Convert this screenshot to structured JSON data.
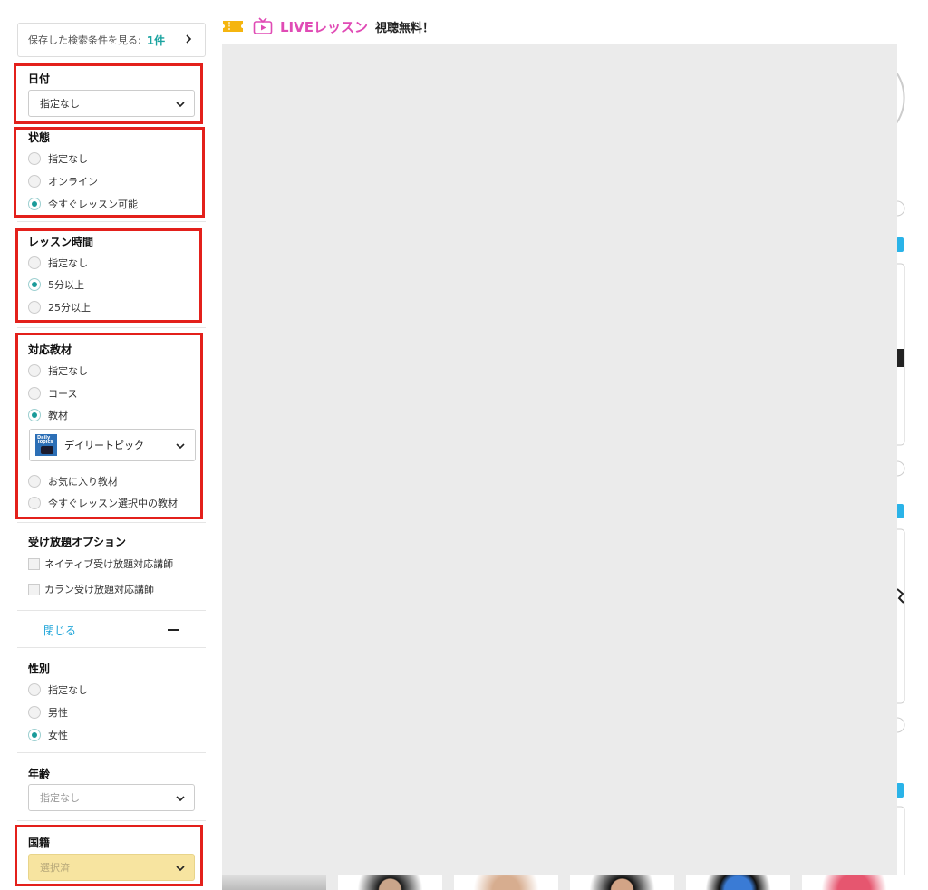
{
  "sidebar": {
    "saved_search": {
      "label": "保存した検索条件を見る:",
      "count": "1件"
    },
    "date": {
      "title": "日付",
      "value": "指定なし"
    },
    "status": {
      "title": "状態",
      "options": [
        "指定なし",
        "オンライン",
        "今すぐレッスン可能"
      ],
      "selected": "今すぐレッスン可能"
    },
    "lesson_time": {
      "title": "レッスン時間",
      "options": [
        "指定なし",
        "5分以上",
        "25分以上"
      ],
      "selected": "5分以上"
    },
    "material": {
      "title": "対応教材",
      "options": [
        "指定なし",
        "コース",
        "教材"
      ],
      "selected": "教材",
      "dropdown_value": "デイリートピック",
      "thumb_text": "Daily Topics",
      "extra_options": [
        "お気に入り教材",
        "今すぐレッスン選択中の教材"
      ]
    },
    "unlimited": {
      "title": "受け放題オプション",
      "options": [
        "ネイティブ受け放題対応講師",
        "カラン受け放題対応講師"
      ]
    },
    "close_label": "閉じる",
    "gender": {
      "title": "性別",
      "options": [
        "指定なし",
        "男性",
        "女性"
      ],
      "selected": "女性"
    },
    "age": {
      "title": "年齢",
      "value": "指定なし"
    },
    "nationality": {
      "title": "国籍",
      "value": "選択済"
    }
  },
  "main": {
    "live_title": "LIVEレッスン",
    "live_sub": "視聴無料！"
  },
  "colors": {
    "accent_teal": "#1a9b9a",
    "link_blue": "#1aa3d8",
    "live_pink": "#e04bb5",
    "highlight_red": "#e3201b",
    "selected_yellow": "#f7e4a0"
  }
}
